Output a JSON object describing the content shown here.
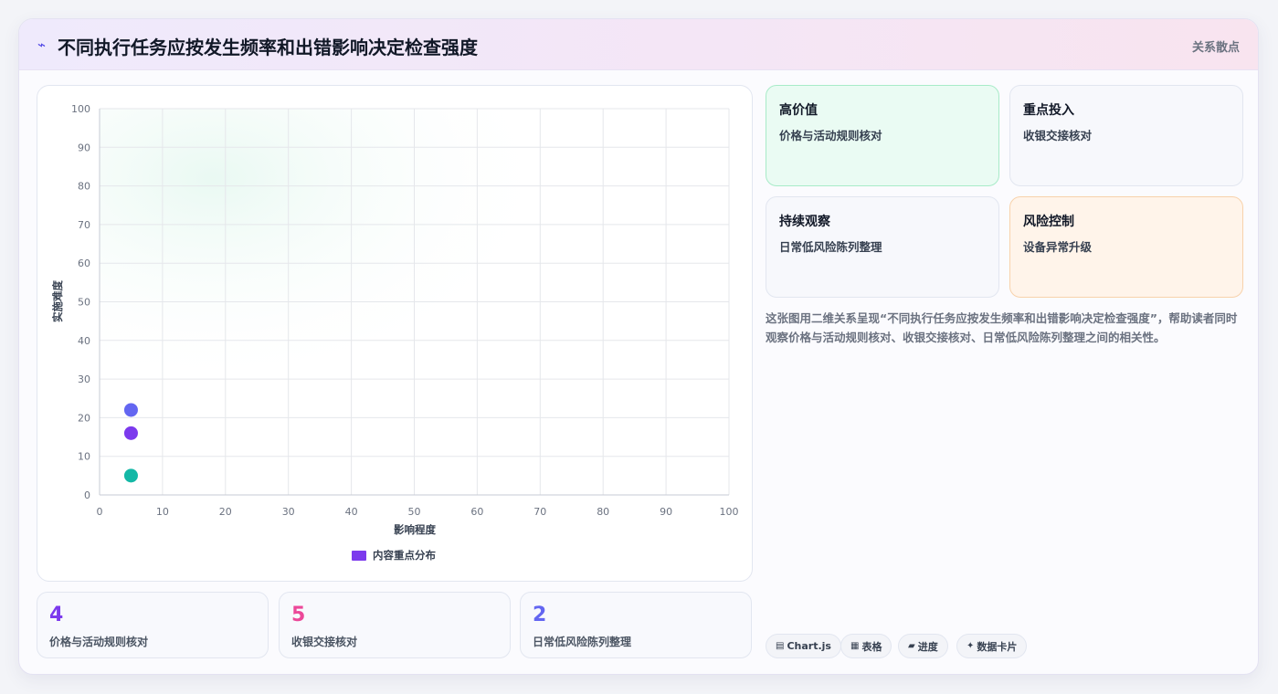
{
  "header": {
    "title": "不同执行任务应按发生频率和出错影响决定检查强度",
    "tag": "关系散点"
  },
  "chart_data": {
    "type": "scatter",
    "xlabel": "影响程度",
    "ylabel": "实施难度",
    "xlim": [
      0,
      100
    ],
    "ylim": [
      0,
      100
    ],
    "xticks": [
      "0",
      "10",
      "20",
      "30",
      "40",
      "50",
      "60",
      "70",
      "80",
      "90",
      "100"
    ],
    "yticks": [
      "0",
      "10",
      "20",
      "30",
      "40",
      "50",
      "60",
      "70",
      "80",
      "90",
      "100"
    ],
    "grid": true,
    "legend_position": "bottom",
    "series": [
      {
        "name": "内容重点分布",
        "legend_color": "#7c3aed",
        "points": [
          {
            "x": 5,
            "y": 22,
            "color": "#6366f1"
          },
          {
            "x": 5,
            "y": 16,
            "color": "#7c3aed"
          },
          {
            "x": 5,
            "y": 5,
            "color": "#14b8a6"
          }
        ]
      }
    ]
  },
  "stats": [
    {
      "value": "4",
      "label": "价格与活动规则核对",
      "color": "#7c3aed"
    },
    {
      "value": "5",
      "label": "收银交接核对",
      "color": "#ec4899"
    },
    {
      "value": "2",
      "label": "日常低风险陈列整理",
      "color": "#6366f1"
    }
  ],
  "quadrants": [
    {
      "title": "高价值",
      "desc": "价格与活动规则核对"
    },
    {
      "title": "重点投入",
      "desc": "收银交接核对"
    },
    {
      "title": "持续观察",
      "desc": "日常低风险陈列整理"
    },
    {
      "title": "风险控制",
      "desc": "设备异常升级"
    }
  ],
  "description": "这张图用二维关系呈现“不同执行任务应按发生频率和出错影响决定检查强度”，帮助读者同时观察价格与活动规则核对、收银交接核对、日常低风险陈列整理之间的相关性。",
  "pills": [
    {
      "icon": "▤",
      "label": "Chart.js"
    },
    {
      "icon": "▦",
      "label": "表格"
    },
    {
      "icon": "▰",
      "label": "进度"
    },
    {
      "icon": "✦",
      "label": "数据卡片"
    }
  ],
  "colors": {
    "accent": "#4f46e5",
    "grid": "#e5e7eb"
  }
}
